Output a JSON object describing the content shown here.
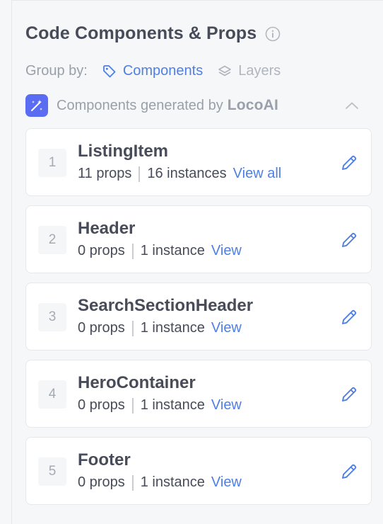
{
  "header": {
    "title": "Code Components & Props"
  },
  "group_by": {
    "label": "Group by:",
    "options": [
      {
        "label": "Components",
        "icon": "tag-icon",
        "active": true
      },
      {
        "label": "Layers",
        "icon": "layers-icon",
        "active": false
      }
    ]
  },
  "generated": {
    "text": "Components generated by",
    "brand": "LocoAI"
  },
  "components": [
    {
      "index": "1",
      "name": "ListingItem",
      "props": "11 props",
      "instances": "16 instances",
      "link": "View all"
    },
    {
      "index": "2",
      "name": "Header",
      "props": "0 props",
      "instances": "1 instance",
      "link": "View"
    },
    {
      "index": "3",
      "name": "SearchSectionHeader",
      "props": "0 props",
      "instances": "1 instance",
      "link": "View"
    },
    {
      "index": "4",
      "name": "HeroContainer",
      "props": "0 props",
      "instances": "1 instance",
      "link": "View"
    },
    {
      "index": "5",
      "name": "Footer",
      "props": "0 props",
      "instances": "1 instance",
      "link": "View"
    }
  ],
  "colors": {
    "accent": "#4f7fe3",
    "badge": "#5a6cf2",
    "muted": "#9aa0aa"
  }
}
